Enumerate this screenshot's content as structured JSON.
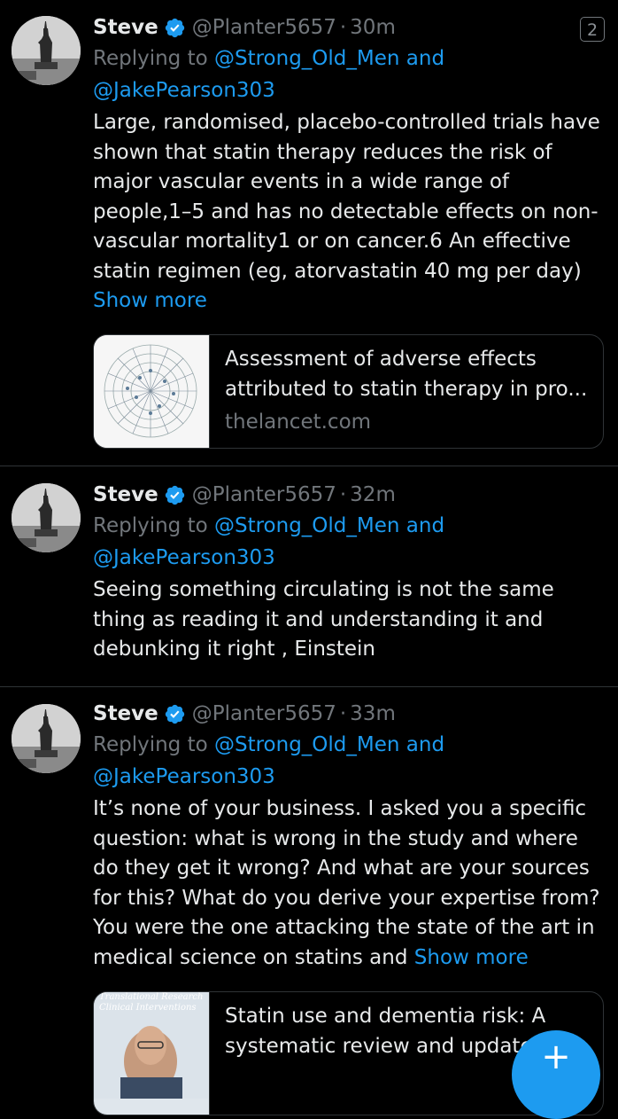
{
  "tweets": [
    {
      "name": "Steve",
      "handle": "@Planter5657",
      "dot": "·",
      "time": "30m",
      "badge": "2",
      "replying_prefix": "Replying to",
      "mention1": "@Strong_Old_Men",
      "and_word": "and",
      "mention2": "@JakePearson303",
      "body": "Large, randomised, placebo-controlled trials have shown that statin therapy reduces the risk of major vascular events in a wide range of people,1–5 and has no detectable effects on non-vascular mortality1 or on cancer.6 An effective statin regimen (eg, atorvastatin 40 mg per day)",
      "show_more": "Show more",
      "card": {
        "title": "Assessment of adverse effects attributed to statin therapy in pro...",
        "domain": "thelancet.com"
      }
    },
    {
      "name": "Steve",
      "handle": "@Planter5657",
      "dot": "·",
      "time": "32m",
      "replying_prefix": "Replying to",
      "mention1": "@Strong_Old_Men",
      "and_word": "and",
      "mention2": "@JakePearson303",
      "body": "Seeing something circulating is not the same thing as reading it and understanding it and debunking it right , Einstein"
    },
    {
      "name": "Steve",
      "handle": "@Planter5657",
      "dot": "·",
      "time": "33m",
      "replying_prefix": "Replying to",
      "mention1": "@Strong_Old_Men",
      "and_word": "and",
      "mention2": "@JakePearson303",
      "body": "It’s none of your business. I asked you a specific question:  what is wrong in the study and where do they get it wrong? And what are your sources for this? What do you derive your expertise from? You were the one attacking the state of the art in medical science on statins  and",
      "show_more": "Show more",
      "card": {
        "title": "Statin use and dementia risk: A systematic review and updated",
        "thumb_line1": "Translational Research",
        "thumb_line2": "Clinical Interventions"
      }
    }
  ],
  "fab": {
    "icon": "compose-plus-icon",
    "glyph": "+"
  },
  "colors": {
    "background": "#000000",
    "accent": "#1d9bf0",
    "muted": "#71767b",
    "text": "#e7e9ea",
    "divider": "#2f3336"
  }
}
